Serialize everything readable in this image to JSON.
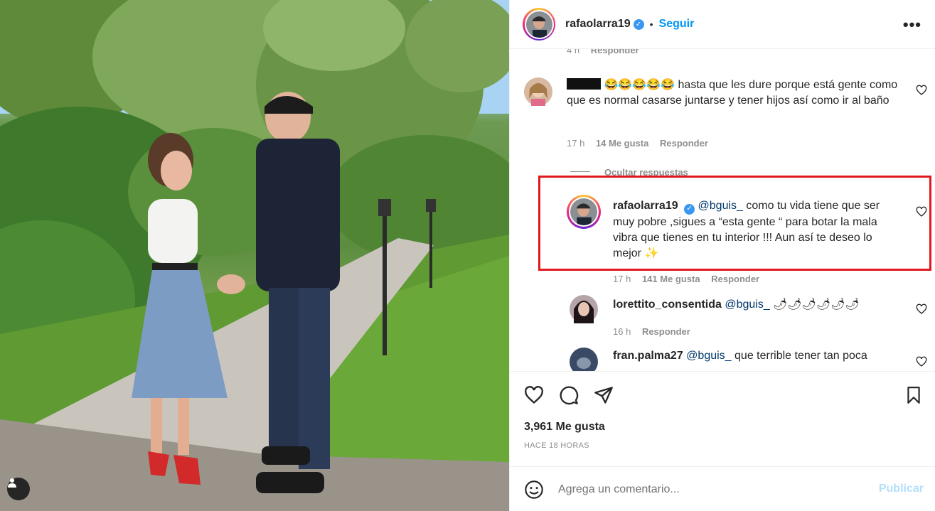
{
  "post": {
    "username": "rafaolarra19",
    "follow_label": "Seguir",
    "separator": "•",
    "more_label": "•••"
  },
  "comments": {
    "top_partial": {
      "time": "4 h",
      "reply": "Responder"
    },
    "c1": {
      "emojis": "😂😂😂😂😂",
      "text": "hasta que les dure porque está gente como que es normal casarse juntarse y tener hijos así como ir al baño",
      "time": "17 h",
      "likes": "14 Me gusta",
      "reply": "Responder"
    },
    "hide_replies": "Ocultar respuestas",
    "r1": {
      "user": "rafaolarra19",
      "mention": "@bguis_",
      "text": "como tu vida tiene que ser muy pobre ,sigues a “esta gente “ para botar la mala vibra que tienes en tu interior !!! Aun así te deseo lo mejor ✨",
      "time": "17 h",
      "likes": "141 Me gusta",
      "reply": "Responder"
    },
    "r2": {
      "user": "lorettito_consentida",
      "mention": "@bguis_",
      "text": "🌶🌶🌶🌶🌶🌶",
      "time": "16 h",
      "reply": "Responder"
    },
    "r3": {
      "user": "fran.palma27",
      "mention": "@bguis_",
      "text": "que terrible tener tan poca"
    }
  },
  "actions": {
    "likes": "3,961 Me gusta",
    "time_ago": "HACE 18 HORAS"
  },
  "composer": {
    "placeholder": "Agrega un comentario...",
    "publish": "Publicar"
  },
  "colors": {
    "link_blue": "#0095f6",
    "highlight_red": "#e0191f",
    "publish_disabled": "#b2dffc"
  }
}
